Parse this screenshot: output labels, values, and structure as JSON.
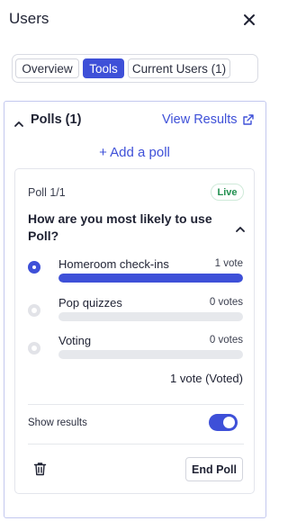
{
  "header": {
    "title": "Users",
    "close_icon": "close-icon"
  },
  "tabs": [
    {
      "label": "Overview",
      "active": false
    },
    {
      "label": "Tools",
      "active": true
    },
    {
      "label": "Current Users (1)",
      "active": false
    }
  ],
  "polls": {
    "title": "Polls (1)",
    "view_results_label": "View Results",
    "add_poll_label": "+ Add a poll",
    "icons": {
      "collapse": "chevron-up-icon",
      "external": "external-link-icon"
    }
  },
  "poll": {
    "count": "Poll 1/1",
    "status": "Live",
    "question": "How are you most likely to use Poll?",
    "options": [
      {
        "label": "Homeroom check-ins",
        "votes": "1 vote",
        "fraction": 1.0,
        "selected": true
      },
      {
        "label": "Pop quizzes",
        "votes": "0 votes",
        "fraction": 0,
        "selected": false
      },
      {
        "label": "Voting",
        "votes": "0 votes",
        "fraction": 0,
        "selected": false
      }
    ],
    "total": "1 vote (Voted)",
    "show_results_label": "Show results",
    "show_results_on": true,
    "end_poll_label": "End Poll",
    "delete_icon": "trash-icon"
  },
  "colors": {
    "accent": "#3e50d8",
    "live": "#1f8f4e",
    "track": "#e6e8ec"
  }
}
